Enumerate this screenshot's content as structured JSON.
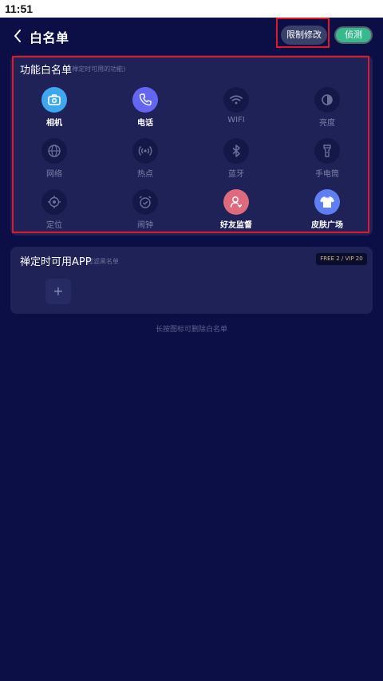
{
  "status_bar": {
    "time": "11:51"
  },
  "header": {
    "title": "白名单",
    "limit_button": "限制修改",
    "detect_toggle": "侦测"
  },
  "function_whitelist": {
    "title": "功能白名单",
    "subtitle": "(禅定时可用的功能)",
    "items": [
      {
        "label": "相机",
        "icon": "camera-icon",
        "active": true
      },
      {
        "label": "电话",
        "icon": "phone-icon",
        "active": true
      },
      {
        "label": "WIFI",
        "icon": "wifi-icon",
        "active": false
      },
      {
        "label": "亮度",
        "icon": "brightness-icon",
        "active": false
      },
      {
        "label": "网络",
        "icon": "globe-icon",
        "active": false
      },
      {
        "label": "热点",
        "icon": "hotspot-icon",
        "active": false
      },
      {
        "label": "蓝牙",
        "icon": "bluetooth-icon",
        "active": false
      },
      {
        "label": "手电筒",
        "icon": "flashlight-icon",
        "active": false
      },
      {
        "label": "定位",
        "icon": "location-icon",
        "active": false
      },
      {
        "label": "闹钟",
        "icon": "alarm-icon",
        "active": false
      },
      {
        "label": "好友监督",
        "icon": "friend-supervise-icon",
        "active": true
      },
      {
        "label": "皮肤广场",
        "icon": "skin-shirt-icon",
        "active": true
      }
    ]
  },
  "app_whitelist": {
    "title": "禅定时可用APP",
    "subtitle": "过滤黑名单",
    "plan_badge": "FREE 2 / VIP 20",
    "add_symbol": "+"
  },
  "hint": "长按图标可删除白名单",
  "colors": {
    "background": "#0c0f45",
    "card": "#1e2257",
    "camera": "#3fa7ee",
    "phone": "#6366f0",
    "friend": "#e06a7d",
    "skin": "#5f7ef2",
    "toggle": "#36b98d",
    "highlight": "#e0182a"
  }
}
